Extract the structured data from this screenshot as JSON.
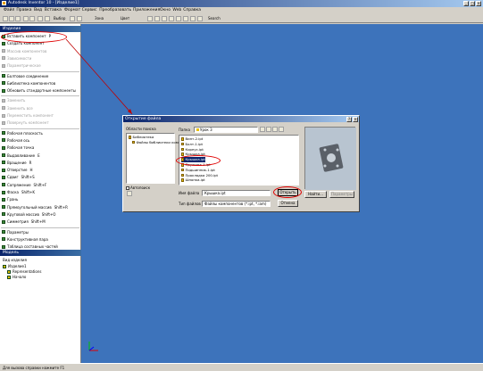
{
  "window": {
    "title": "Autodesk Inventor 10 - [Изделие1]"
  },
  "menubar": [
    "Файл",
    "Правка",
    "Вид",
    "Вставка",
    "Формат",
    "Сервис",
    "Преобразовать",
    "Приложения",
    "Окно",
    "Web",
    "Справка"
  ],
  "toolbar": {
    "select_label": "Выбор",
    "material_label": "Зона",
    "view_label": "Цвет",
    "search_label": "Search"
  },
  "panel": {
    "header": "Изделие",
    "items": [
      "Вставить компонент",
      "Создать компонент",
      "Массив компонентов",
      "Зависимости",
      "Параметрическое",
      "Болтовое соединение",
      "Библиотека компонентов",
      "Обновить стандартные компоненты",
      "Заменить",
      "Заменить все",
      "Переместить компонент",
      "Повернуть компонент",
      "Рабочая плоскость",
      "Рабочая ось",
      "Рабочая точка",
      "Выдавливание",
      "Вращение",
      "Отверстие",
      "Сдвиг",
      "Сопряжение",
      "Фаска",
      "Грань",
      "Прямоугольный массив",
      "Круговой массив",
      "Симметрия",
      "Параметры",
      "Конструктивная пара",
      "Таблица составных частей"
    ],
    "shortcuts": [
      "P",
      "",
      "",
      "",
      "",
      "",
      "",
      "",
      "",
      "",
      "",
      "",
      "",
      "",
      "",
      "E",
      "R",
      "H",
      "Shift+S",
      "Shift+F",
      "Shift+K",
      "",
      "Shift+R",
      "Shift+O",
      "Shift+M",
      "",
      "",
      ""
    ]
  },
  "browser": {
    "header": "Модель",
    "view_label": "Вид изделия",
    "tree": [
      "Изделие1",
      "Representations",
      "Начало"
    ]
  },
  "dialog": {
    "title": "Открытие файла",
    "location_label": "Области поиска",
    "locations": [
      "Библиотека",
      "Файлы библиотеки компон..."
    ],
    "lookin_label": "Папка",
    "lookin_value": "Урок 3",
    "files": [
      "Винт-2.ipt",
      "Болт-1.ipt",
      "Корпус.ipt",
      "Крышка.ipt",
      "Крышка.ipt",
      "Пружина-1.ipt",
      "Подшипник-1.ipt",
      "Прокладка 200.ipt",
      "Шпонка.ipt"
    ],
    "selected_index": 4,
    "filename_label": "Имя файла",
    "filename_value": "Крышка.ipt",
    "filetype_label": "Тип файлов",
    "filetype_value": "Файлы компонентов (*.ipt, *.iam)",
    "autosearch_label": "Автопоиск",
    "open_button": "Открыть",
    "cancel_button": "Отмена",
    "find_button": "Найти...",
    "options_button": "Параметры"
  },
  "statusbar": {
    "text": "Для вызова справки нажмите F1"
  },
  "colors": {
    "viewport": "#3d73bb",
    "title_dark": "#0a246a",
    "highlight": "#e00000"
  }
}
